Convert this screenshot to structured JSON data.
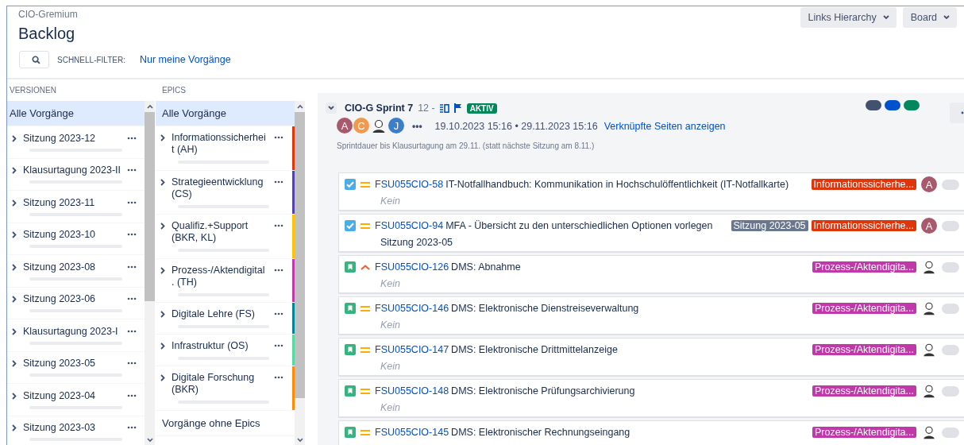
{
  "header": {
    "project": "CIO-Gremium",
    "title": "Backlog",
    "quick_filter_label": "SCHNELL-FILTER:",
    "quick_filters": [
      {
        "label": "Nur meine Vorgänge",
        "selected": false
      }
    ],
    "buttons": [
      {
        "label": "Links Hierarchy"
      },
      {
        "label": "Board"
      }
    ]
  },
  "versions": {
    "heading": "VERSIONEN",
    "items": [
      {
        "label": "Alle Vorgänge",
        "kind": "all",
        "selected": true
      },
      {
        "label": "Sitzung 2023-12",
        "kind": "version",
        "selected": false
      },
      {
        "label": "Klausurtagung 2023-II",
        "kind": "version",
        "selected": false
      },
      {
        "label": "Sitzung 2023-11",
        "kind": "version",
        "selected": false
      },
      {
        "label": "Sitzung 2023-10",
        "kind": "version",
        "selected": false
      },
      {
        "label": "Sitzung 2023-08",
        "kind": "version",
        "selected": false
      },
      {
        "label": "Sitzung 2023-06",
        "kind": "version",
        "selected": false
      },
      {
        "label": "Klausurtagung 2023-I",
        "kind": "version",
        "selected": false
      },
      {
        "label": "Sitzung 2023-05",
        "kind": "version",
        "selected": false
      },
      {
        "label": "Sitzung 2023-04",
        "kind": "version",
        "selected": false
      },
      {
        "label": "Sitzung 2023-03",
        "kind": "version",
        "selected": false
      }
    ]
  },
  "epics": {
    "heading": "EPICS",
    "items": [
      {
        "label": "Alle Vorgänge",
        "kind": "all",
        "selected": true
      },
      {
        "label": "Informationssicherheit (AH)",
        "kind": "epic",
        "color": "#de350b",
        "selected": false
      },
      {
        "label": "Strategieentwicklung (CS)",
        "kind": "epic",
        "color": "#5243aa",
        "selected": false
      },
      {
        "label": "Qualifiz.+Support (BKR, KL)",
        "kind": "epic",
        "color": "#ffc400",
        "selected": false
      },
      {
        "label": "Prozess-/Aktendigital. (TH)",
        "kind": "epic",
        "color": "#c039a8",
        "selected": false
      },
      {
        "label": "Digitale Lehre (FS)",
        "kind": "epic",
        "color": "#00849a",
        "selected": false
      },
      {
        "label": "Infrastruktur (OS)",
        "kind": "epic",
        "color": "#57d9a3",
        "selected": false
      },
      {
        "label": "Digitale Forschung (BKR)",
        "kind": "epic",
        "color": "#ff8b00",
        "selected": false
      },
      {
        "label": "Vorgänge ohne Epics",
        "kind": "none",
        "selected": false
      }
    ]
  },
  "sprint": {
    "name": "CIO-G Sprint 7",
    "count": "12 -",
    "status": "AKTIV",
    "status_dots": [
      {
        "color": "#42526e"
      },
      {
        "color": "#0052cc"
      },
      {
        "color": "#00875a"
      }
    ],
    "people": [
      {
        "kind": "letter",
        "letter": "A",
        "color": "#a8596b"
      },
      {
        "kind": "letter",
        "letter": "C",
        "color": "#f1994c"
      },
      {
        "kind": "face"
      },
      {
        "kind": "letter",
        "letter": "J",
        "color": "#3d7ecb"
      }
    ],
    "more": "•••",
    "dates": "19.10.2023 15:16 • 29.11.2023 15:16",
    "link": "Verknüpfte Seiten anzeigen",
    "goal": "Sprintdauer bis Klausurtagung am 29.11. (statt nächste Sitzung am 8.11.)",
    "issues": [
      {
        "kind": "task",
        "priority": {
          "kind": "medium"
        },
        "key": "FSU055CIO-58",
        "summary": "IT-Notfallhandbuch: Kommunikation in Hochschulöffentlichkeit (IT-Notfallkarte)",
        "fix_version": {
          "text": "Kein",
          "empty": true
        },
        "epic": {
          "label": "Informationssicherhe...",
          "color": "#de350b"
        },
        "assignee": {
          "kind": "letter",
          "letter": "A",
          "color": "#a8596b"
        }
      },
      {
        "kind": "task",
        "priority": {
          "kind": "medium"
        },
        "key": "FSU055CIO-94",
        "summary": "MFA - Übersicht zu den unterschiedlichen Optionen vorlegen",
        "version_badge": "Sitzung 2023-05",
        "fix_version": {
          "text": "Sitzung 2023-05",
          "empty": false
        },
        "epic": {
          "label": "Informationssicherhe...",
          "color": "#de350b"
        },
        "assignee": {
          "kind": "letter",
          "letter": "A",
          "color": "#a8596b"
        }
      },
      {
        "kind": "story",
        "priority": {
          "kind": "high"
        },
        "key": "FSU055CIO-126",
        "summary": "DMS: Abnahme",
        "fix_version": {
          "text": "Kein",
          "empty": true
        },
        "epic": {
          "label": "Prozess-/Aktendigita...",
          "color": "#c039a8"
        },
        "assignee": {
          "kind": "face"
        }
      },
      {
        "kind": "story",
        "priority": {
          "kind": "medium"
        },
        "key": "FSU055CIO-146",
        "summary": "DMS: Elektronische Dienstreiseverwaltung",
        "fix_version": {
          "text": "Kein",
          "empty": true
        },
        "epic": {
          "label": "Prozess-/Aktendigita...",
          "color": "#c039a8"
        },
        "assignee": {
          "kind": "face"
        }
      },
      {
        "kind": "story",
        "priority": {
          "kind": "medium"
        },
        "key": "FSU055CIO-147",
        "summary": "DMS: Elektronische Drittmittelanzeige",
        "fix_version": {
          "text": "Kein",
          "empty": true
        },
        "epic": {
          "label": "Prozess-/Aktendigita...",
          "color": "#c039a8"
        },
        "assignee": {
          "kind": "face"
        }
      },
      {
        "kind": "story",
        "priority": {
          "kind": "medium"
        },
        "key": "FSU055CIO-148",
        "summary": "DMS: Elektronische Prüfungsarchivierung",
        "fix_version": {
          "text": "Kein",
          "empty": true
        },
        "epic": {
          "label": "Prozess-/Aktendigita...",
          "color": "#c039a8"
        },
        "assignee": {
          "kind": "face"
        }
      },
      {
        "kind": "story",
        "priority": {
          "kind": "medium"
        },
        "key": "FSU055CIO-145",
        "summary": "DMS: Elektronischer Rechnungseingang",
        "epic": {
          "label": "Prozess-/Aktendigita...",
          "color": "#c039a8"
        },
        "assignee": {
          "kind": "face"
        }
      }
    ]
  }
}
